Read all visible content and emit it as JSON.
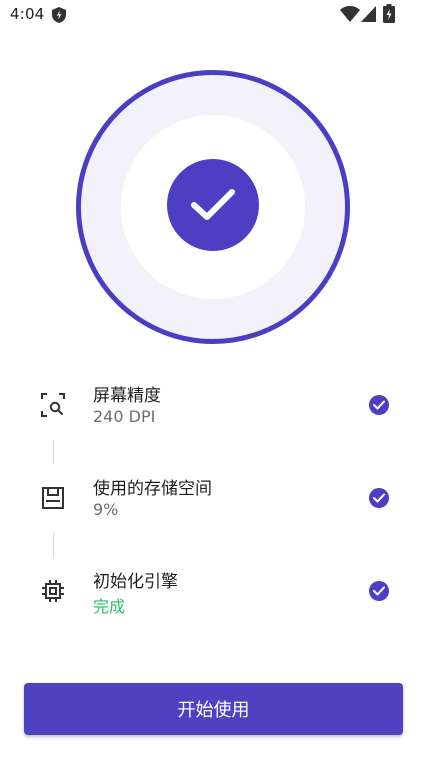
{
  "status_bar": {
    "time": "4:04",
    "icons": [
      "shield-icon",
      "wifi-icon",
      "signal-icon",
      "battery-charging-icon"
    ]
  },
  "colors": {
    "accent": "#4e3ec3",
    "ring_fill": "#f3f2fb",
    "success": "#2bbf62",
    "secondary_text": "#6f6f6f"
  },
  "hero": {
    "icon": "check-icon",
    "state": "complete"
  },
  "checklist": [
    {
      "icon": "screen-search-icon",
      "title": "屏幕精度",
      "value": "240 DPI",
      "status": "done"
    },
    {
      "icon": "storage-icon",
      "title": "使用的存储空间",
      "value": "9%",
      "status": "done"
    },
    {
      "icon": "chip-icon",
      "title": "初始化引擎",
      "value": "完成",
      "status": "done"
    }
  ],
  "primary_button": {
    "label": "开始使用"
  }
}
